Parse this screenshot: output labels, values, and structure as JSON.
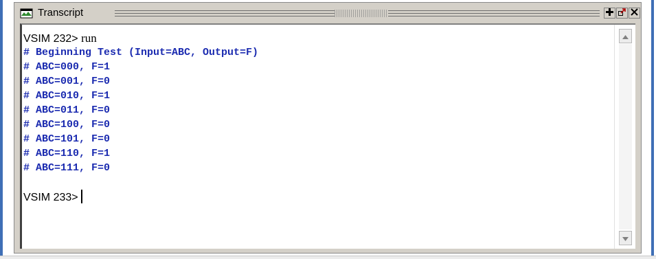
{
  "window": {
    "title": "Transcript",
    "icon": "transcript-window-icon",
    "buttons": [
      {
        "name": "add-pane-button",
        "icon": "plus-icon"
      },
      {
        "name": "undock-button",
        "icon": "undock-icon"
      },
      {
        "name": "close-button",
        "icon": "close-icon"
      }
    ]
  },
  "transcript": {
    "first_prompt": "VSIM 232>",
    "first_command": "run",
    "output": [
      "# Beginning Test (Input=ABC, Output=F)",
      "# ABC=000, F=1",
      "# ABC=001, F=0",
      "# ABC=010, F=1",
      "# ABC=011, F=0",
      "# ABC=100, F=0",
      "# ABC=101, F=0",
      "# ABC=110, F=1",
      "# ABC=111, F=0"
    ],
    "blank": "",
    "current_prompt": "VSIM 233>"
  },
  "colors": {
    "echo_text": "#1b2bb0",
    "prompt_text": "#000000",
    "frame_blue": "#3f6fb6",
    "window_gray": "#d4d0c8"
  }
}
